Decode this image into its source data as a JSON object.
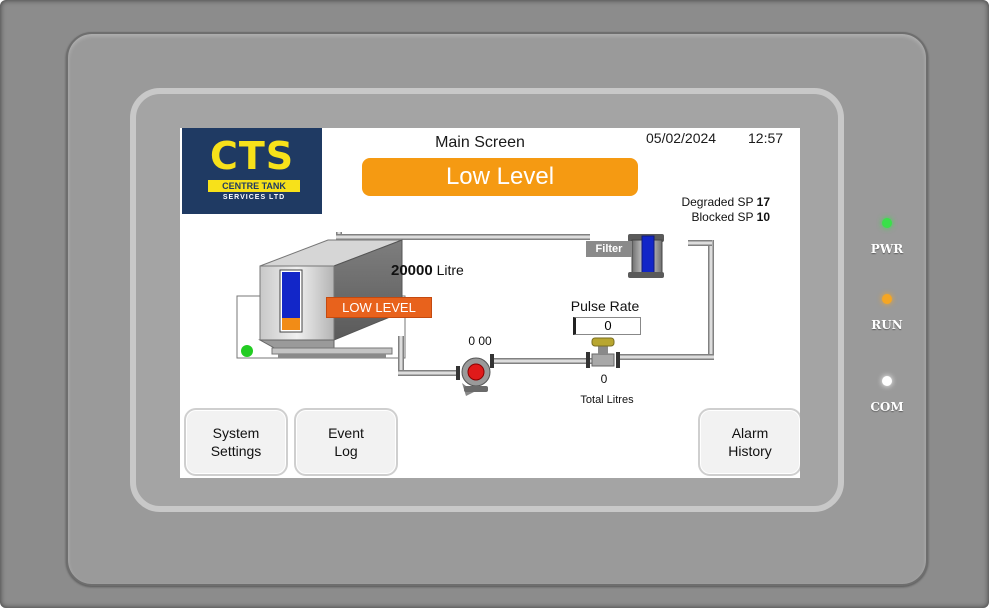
{
  "hmi": {
    "logo": {
      "main": "CTS",
      "band": "CENTRE TANK",
      "sub": "SERVICES LTD"
    },
    "header": {
      "title": "Main Screen",
      "date": "05/02/2024",
      "time": "12:57",
      "status": "Low Level"
    },
    "setpoints": {
      "degraded_label": "Degraded SP",
      "degraded_value": "17",
      "blocked_label": "Blocked SP",
      "blocked_value": "10"
    },
    "tank": {
      "volume_value": "20000",
      "volume_unit": "Litre",
      "alarm_label": "LOW LEVEL",
      "level_fraction": 0.2
    },
    "filter": {
      "label": "Filter"
    },
    "pump": {
      "counter": "0 00"
    },
    "meter": {
      "pulse_rate_label": "Pulse Rate",
      "pulse_rate_value": "0",
      "total_value": "0",
      "total_label": "Total Litres"
    },
    "buttons": {
      "system_settings": "System\nSettings",
      "event_log": "Event\nLog",
      "alarm_history": "Alarm\nHistory"
    }
  },
  "indicators": {
    "pwr": {
      "label": "PWR",
      "color": "#39e04a"
    },
    "run": {
      "label": "RUN",
      "color": "#f5a623"
    },
    "com": {
      "label": "COM",
      "color": "#ffffff"
    }
  },
  "colors": {
    "status_orange": "#f59a12",
    "alarm_orange": "#e8621c",
    "logo_navy": "#1f3a63",
    "logo_yellow": "#f7e11a",
    "level_blue": "#1226c8",
    "level_orange": "#f28c16",
    "pump_red": "#e01a1a",
    "status_led_green": "#22cc22"
  }
}
